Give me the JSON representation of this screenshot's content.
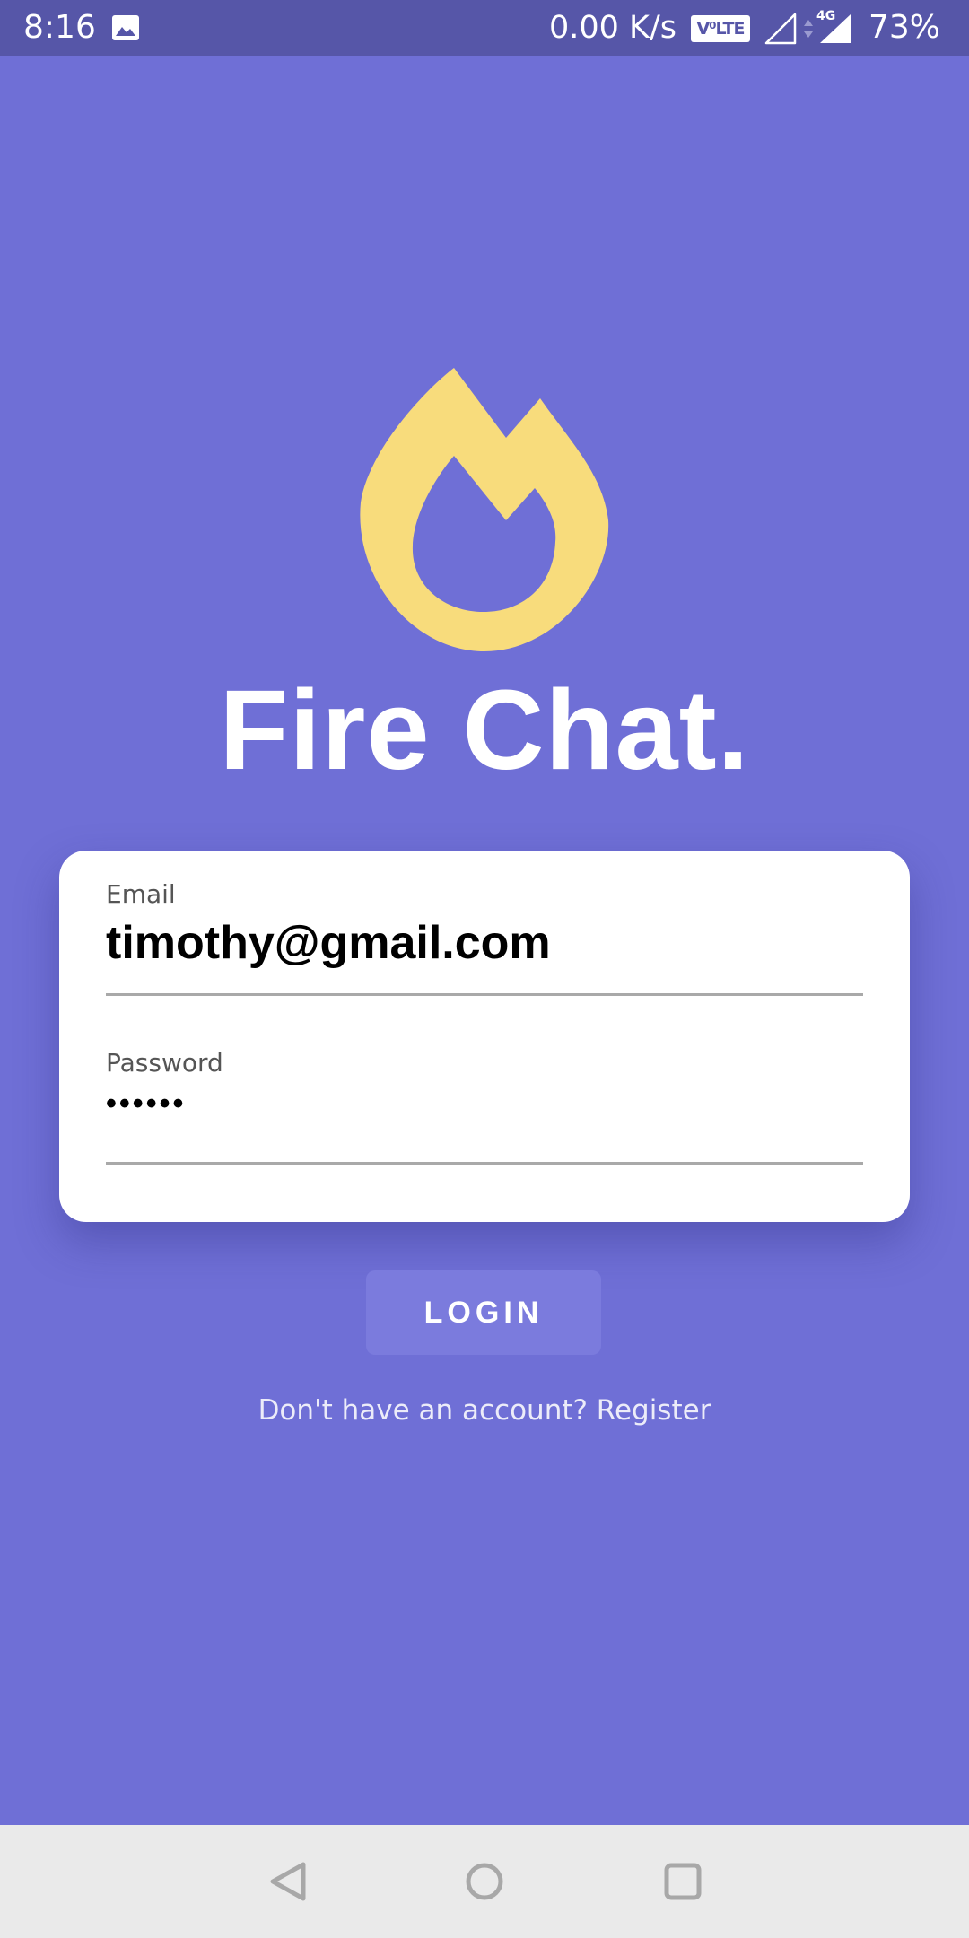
{
  "status_bar": {
    "time": "8:16",
    "net_speed": "0.00 K/s",
    "volte": "V⁰LTE",
    "network_type": "4G",
    "battery": "73%",
    "icons": [
      "gallery-icon",
      "volte-icon",
      "signal-icon",
      "data-arrows-icon",
      "signal-4g-icon"
    ]
  },
  "app": {
    "logo_icon": "flame-icon",
    "title": "Fire Chat."
  },
  "login_form": {
    "email_label": "Email",
    "email_value": "timothy@gmail.com",
    "password_label": "Password",
    "password_value": "••••••"
  },
  "login_button": "LOGIN",
  "register_prompt": "Don't have an account? Register",
  "nav_bar": {
    "icons": [
      "back-icon",
      "home-icon",
      "recents-icon"
    ]
  },
  "colors": {
    "background": "#6f6fd6",
    "status_bar": "#5656a8",
    "logo": "#f8dc7c",
    "card": "#ffffff",
    "button": "#7b7bdd",
    "nav_bar": "#eaeaea"
  }
}
